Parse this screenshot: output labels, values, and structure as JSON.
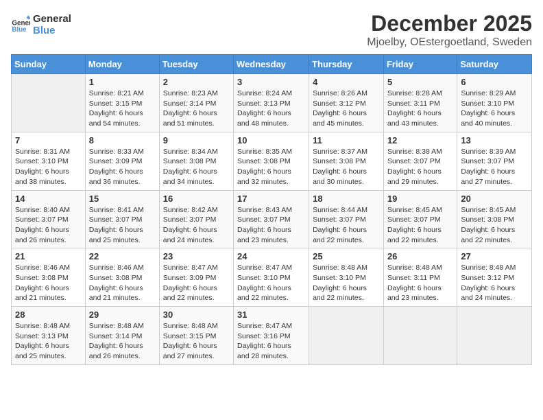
{
  "header": {
    "logo_general": "General",
    "logo_blue": "Blue",
    "month_title": "December 2025",
    "location": "Mjoelby, OEstergoetland, Sweden"
  },
  "weekdays": [
    "Sunday",
    "Monday",
    "Tuesday",
    "Wednesday",
    "Thursday",
    "Friday",
    "Saturday"
  ],
  "weeks": [
    [
      {
        "day": "",
        "sunrise": "",
        "sunset": "",
        "daylight": ""
      },
      {
        "day": "1",
        "sunrise": "Sunrise: 8:21 AM",
        "sunset": "Sunset: 3:15 PM",
        "daylight": "Daylight: 6 hours and 54 minutes."
      },
      {
        "day": "2",
        "sunrise": "Sunrise: 8:23 AM",
        "sunset": "Sunset: 3:14 PM",
        "daylight": "Daylight: 6 hours and 51 minutes."
      },
      {
        "day": "3",
        "sunrise": "Sunrise: 8:24 AM",
        "sunset": "Sunset: 3:13 PM",
        "daylight": "Daylight: 6 hours and 48 minutes."
      },
      {
        "day": "4",
        "sunrise": "Sunrise: 8:26 AM",
        "sunset": "Sunset: 3:12 PM",
        "daylight": "Daylight: 6 hours and 45 minutes."
      },
      {
        "day": "5",
        "sunrise": "Sunrise: 8:28 AM",
        "sunset": "Sunset: 3:11 PM",
        "daylight": "Daylight: 6 hours and 43 minutes."
      },
      {
        "day": "6",
        "sunrise": "Sunrise: 8:29 AM",
        "sunset": "Sunset: 3:10 PM",
        "daylight": "Daylight: 6 hours and 40 minutes."
      }
    ],
    [
      {
        "day": "7",
        "sunrise": "Sunrise: 8:31 AM",
        "sunset": "Sunset: 3:10 PM",
        "daylight": "Daylight: 6 hours and 38 minutes."
      },
      {
        "day": "8",
        "sunrise": "Sunrise: 8:33 AM",
        "sunset": "Sunset: 3:09 PM",
        "daylight": "Daylight: 6 hours and 36 minutes."
      },
      {
        "day": "9",
        "sunrise": "Sunrise: 8:34 AM",
        "sunset": "Sunset: 3:08 PM",
        "daylight": "Daylight: 6 hours and 34 minutes."
      },
      {
        "day": "10",
        "sunrise": "Sunrise: 8:35 AM",
        "sunset": "Sunset: 3:08 PM",
        "daylight": "Daylight: 6 hours and 32 minutes."
      },
      {
        "day": "11",
        "sunrise": "Sunrise: 8:37 AM",
        "sunset": "Sunset: 3:08 PM",
        "daylight": "Daylight: 6 hours and 30 minutes."
      },
      {
        "day": "12",
        "sunrise": "Sunrise: 8:38 AM",
        "sunset": "Sunset: 3:07 PM",
        "daylight": "Daylight: 6 hours and 29 minutes."
      },
      {
        "day": "13",
        "sunrise": "Sunrise: 8:39 AM",
        "sunset": "Sunset: 3:07 PM",
        "daylight": "Daylight: 6 hours and 27 minutes."
      }
    ],
    [
      {
        "day": "14",
        "sunrise": "Sunrise: 8:40 AM",
        "sunset": "Sunset: 3:07 PM",
        "daylight": "Daylight: 6 hours and 26 minutes."
      },
      {
        "day": "15",
        "sunrise": "Sunrise: 8:41 AM",
        "sunset": "Sunset: 3:07 PM",
        "daylight": "Daylight: 6 hours and 25 minutes."
      },
      {
        "day": "16",
        "sunrise": "Sunrise: 8:42 AM",
        "sunset": "Sunset: 3:07 PM",
        "daylight": "Daylight: 6 hours and 24 minutes."
      },
      {
        "day": "17",
        "sunrise": "Sunrise: 8:43 AM",
        "sunset": "Sunset: 3:07 PM",
        "daylight": "Daylight: 6 hours and 23 minutes."
      },
      {
        "day": "18",
        "sunrise": "Sunrise: 8:44 AM",
        "sunset": "Sunset: 3:07 PM",
        "daylight": "Daylight: 6 hours and 22 minutes."
      },
      {
        "day": "19",
        "sunrise": "Sunrise: 8:45 AM",
        "sunset": "Sunset: 3:07 PM",
        "daylight": "Daylight: 6 hours and 22 minutes."
      },
      {
        "day": "20",
        "sunrise": "Sunrise: 8:45 AM",
        "sunset": "Sunset: 3:08 PM",
        "daylight": "Daylight: 6 hours and 22 minutes."
      }
    ],
    [
      {
        "day": "21",
        "sunrise": "Sunrise: 8:46 AM",
        "sunset": "Sunset: 3:08 PM",
        "daylight": "Daylight: 6 hours and 21 minutes."
      },
      {
        "day": "22",
        "sunrise": "Sunrise: 8:46 AM",
        "sunset": "Sunset: 3:08 PM",
        "daylight": "Daylight: 6 hours and 21 minutes."
      },
      {
        "day": "23",
        "sunrise": "Sunrise: 8:47 AM",
        "sunset": "Sunset: 3:09 PM",
        "daylight": "Daylight: 6 hours and 22 minutes."
      },
      {
        "day": "24",
        "sunrise": "Sunrise: 8:47 AM",
        "sunset": "Sunset: 3:10 PM",
        "daylight": "Daylight: 6 hours and 22 minutes."
      },
      {
        "day": "25",
        "sunrise": "Sunrise: 8:48 AM",
        "sunset": "Sunset: 3:10 PM",
        "daylight": "Daylight: 6 hours and 22 minutes."
      },
      {
        "day": "26",
        "sunrise": "Sunrise: 8:48 AM",
        "sunset": "Sunset: 3:11 PM",
        "daylight": "Daylight: 6 hours and 23 minutes."
      },
      {
        "day": "27",
        "sunrise": "Sunrise: 8:48 AM",
        "sunset": "Sunset: 3:12 PM",
        "daylight": "Daylight: 6 hours and 24 minutes."
      }
    ],
    [
      {
        "day": "28",
        "sunrise": "Sunrise: 8:48 AM",
        "sunset": "Sunset: 3:13 PM",
        "daylight": "Daylight: 6 hours and 25 minutes."
      },
      {
        "day": "29",
        "sunrise": "Sunrise: 8:48 AM",
        "sunset": "Sunset: 3:14 PM",
        "daylight": "Daylight: 6 hours and 26 minutes."
      },
      {
        "day": "30",
        "sunrise": "Sunrise: 8:48 AM",
        "sunset": "Sunset: 3:15 PM",
        "daylight": "Daylight: 6 hours and 27 minutes."
      },
      {
        "day": "31",
        "sunrise": "Sunrise: 8:47 AM",
        "sunset": "Sunset: 3:16 PM",
        "daylight": "Daylight: 6 hours and 28 minutes."
      },
      {
        "day": "",
        "sunrise": "",
        "sunset": "",
        "daylight": ""
      },
      {
        "day": "",
        "sunrise": "",
        "sunset": "",
        "daylight": ""
      },
      {
        "day": "",
        "sunrise": "",
        "sunset": "",
        "daylight": ""
      }
    ]
  ]
}
